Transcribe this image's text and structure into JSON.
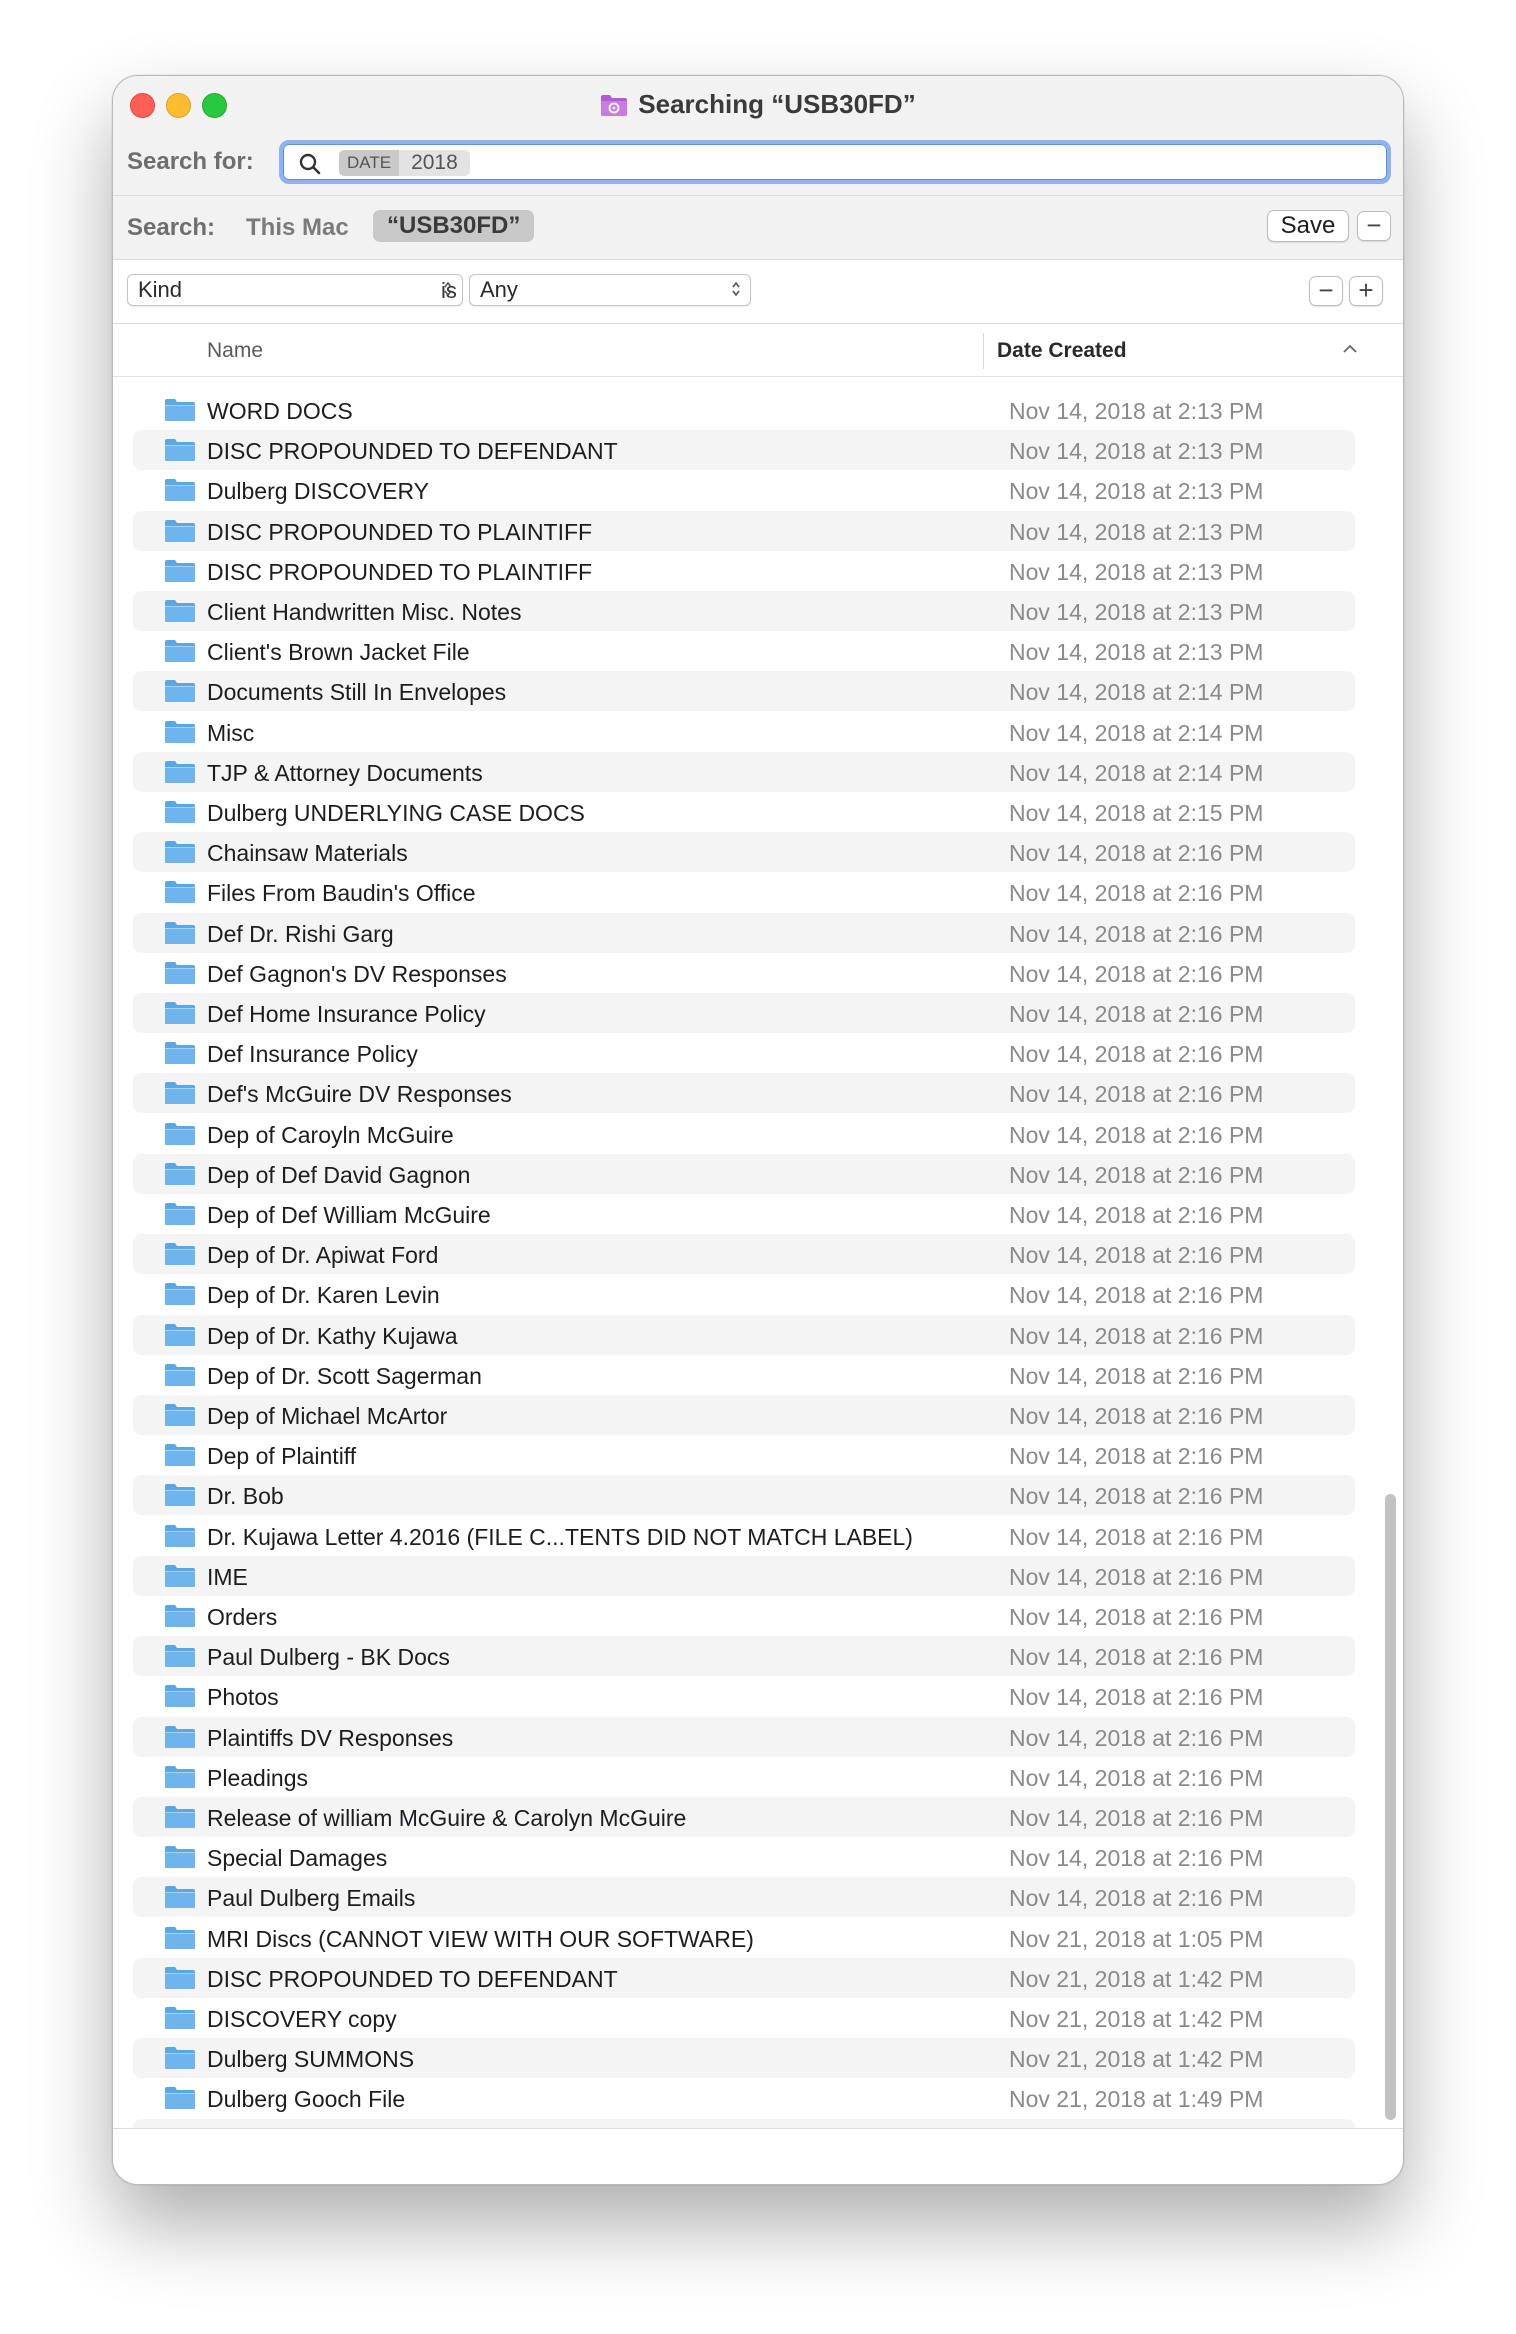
{
  "window": {
    "title": "Searching “USB30FD”"
  },
  "search": {
    "label": "Search for:",
    "token_category": "DATE",
    "token_value": "2018"
  },
  "scope": {
    "label": "Search:",
    "this_mac": "This Mac",
    "selected": "“USB30FD”",
    "save_label": "Save",
    "minus": "−"
  },
  "criteria": {
    "attribute": "Kind",
    "operator": "is",
    "value": "Any",
    "minus": "−",
    "plus": "+"
  },
  "columns": {
    "name": "Name",
    "date": "Date Created"
  },
  "colors": {
    "folder": "#6fb4ec",
    "accent": "#5b8fe5"
  },
  "items": [
    {
      "name": "WORD DOCS",
      "date": "Nov 14, 2018 at 2:13 PM"
    },
    {
      "name": "DISC PROPOUNDED TO DEFENDANT",
      "date": "Nov 14, 2018 at 2:13 PM"
    },
    {
      "name": "Dulberg DISCOVERY",
      "date": "Nov 14, 2018 at 2:13 PM"
    },
    {
      "name": "DISC PROPOUNDED TO PLAINTIFF",
      "date": "Nov 14, 2018 at 2:13 PM"
    },
    {
      "name": "DISC PROPOUNDED TO PLAINTIFF",
      "date": "Nov 14, 2018 at 2:13 PM"
    },
    {
      "name": "Client Handwritten Misc. Notes",
      "date": "Nov 14, 2018 at 2:13 PM"
    },
    {
      "name": "Client's Brown Jacket File",
      "date": "Nov 14, 2018 at 2:13 PM"
    },
    {
      "name": "Documents Still In Envelopes",
      "date": "Nov 14, 2018 at 2:14 PM"
    },
    {
      "name": "Misc",
      "date": "Nov 14, 2018 at 2:14 PM"
    },
    {
      "name": "TJP & Attorney Documents",
      "date": "Nov 14, 2018 at 2:14 PM"
    },
    {
      "name": "Dulberg UNDERLYING CASE DOCS",
      "date": "Nov 14, 2018 at 2:15 PM"
    },
    {
      "name": "Chainsaw Materials",
      "date": "Nov 14, 2018 at 2:16 PM"
    },
    {
      "name": "Files From Baudin's Office",
      "date": "Nov 14, 2018 at 2:16 PM"
    },
    {
      "name": "Def Dr. Rishi Garg",
      "date": "Nov 14, 2018 at 2:16 PM"
    },
    {
      "name": "Def Gagnon's DV Responses",
      "date": "Nov 14, 2018 at 2:16 PM"
    },
    {
      "name": "Def Home Insurance Policy",
      "date": "Nov 14, 2018 at 2:16 PM"
    },
    {
      "name": "Def Insurance Policy",
      "date": "Nov 14, 2018 at 2:16 PM"
    },
    {
      "name": "Def's McGuire DV Responses",
      "date": "Nov 14, 2018 at 2:16 PM"
    },
    {
      "name": "Dep of Caroyln McGuire",
      "date": "Nov 14, 2018 at 2:16 PM"
    },
    {
      "name": "Dep of Def David Gagnon",
      "date": "Nov 14, 2018 at 2:16 PM"
    },
    {
      "name": "Dep of Def William McGuire",
      "date": "Nov 14, 2018 at 2:16 PM"
    },
    {
      "name": "Dep of Dr. Apiwat Ford",
      "date": "Nov 14, 2018 at 2:16 PM"
    },
    {
      "name": "Dep of Dr. Karen Levin",
      "date": "Nov 14, 2018 at 2:16 PM"
    },
    {
      "name": "Dep of Dr. Kathy Kujawa",
      "date": "Nov 14, 2018 at 2:16 PM"
    },
    {
      "name": "Dep of Dr. Scott Sagerman",
      "date": "Nov 14, 2018 at 2:16 PM"
    },
    {
      "name": "Dep of Michael McArtor",
      "date": "Nov 14, 2018 at 2:16 PM"
    },
    {
      "name": "Dep of Plaintiff",
      "date": "Nov 14, 2018 at 2:16 PM"
    },
    {
      "name": "Dr. Bob",
      "date": "Nov 14, 2018 at 2:16 PM"
    },
    {
      "name": "Dr. Kujawa Letter 4.2016 (FILE C...TENTS DID NOT MATCH LABEL)",
      "date": "Nov 14, 2018 at 2:16 PM"
    },
    {
      "name": "IME",
      "date": "Nov 14, 2018 at 2:16 PM"
    },
    {
      "name": "Orders",
      "date": "Nov 14, 2018 at 2:16 PM"
    },
    {
      "name": "Paul Dulberg - BK Docs",
      "date": "Nov 14, 2018 at 2:16 PM"
    },
    {
      "name": "Photos",
      "date": "Nov 14, 2018 at 2:16 PM"
    },
    {
      "name": "Plaintiffs DV Responses",
      "date": "Nov 14, 2018 at 2:16 PM"
    },
    {
      "name": "Pleadings",
      "date": "Nov 14, 2018 at 2:16 PM"
    },
    {
      "name": "Release of william McGuire & Carolyn McGuire",
      "date": "Nov 14, 2018 at 2:16 PM"
    },
    {
      "name": "Special Damages",
      "date": "Nov 14, 2018 at 2:16 PM"
    },
    {
      "name": "Paul Dulberg Emails",
      "date": "Nov 14, 2018 at 2:16 PM"
    },
    {
      "name": "MRI Discs (CANNOT VIEW WITH OUR SOFTWARE)",
      "date": "Nov 21, 2018 at 1:05 PM"
    },
    {
      "name": "DISC PROPOUNDED TO DEFENDANT",
      "date": "Nov 21, 2018 at 1:42 PM"
    },
    {
      "name": "DISCOVERY copy",
      "date": "Nov 21, 2018 at 1:42 PM"
    },
    {
      "name": "Dulberg SUMMONS",
      "date": "Nov 21, 2018 at 1:42 PM"
    },
    {
      "name": "Dulberg Gooch File",
      "date": "Nov 21, 2018 at 1:49 PM"
    }
  ]
}
